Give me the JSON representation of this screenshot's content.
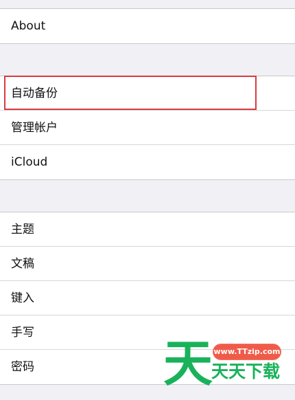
{
  "items": {
    "about": "About",
    "auto_backup": "自动备份",
    "manage_accounts": "管理帐户",
    "icloud": "iCloud",
    "theme": "主题",
    "drafts": "文稿",
    "typing": "键入",
    "handwriting": "手写",
    "password": "密码"
  },
  "watermark": {
    "big_char": "天",
    "url": "www.TTzip.com",
    "text": "天天下载"
  },
  "colors": {
    "highlight": "#d9393f",
    "watermark_green": "#19b25b",
    "watermark_red": "#f05b49"
  }
}
